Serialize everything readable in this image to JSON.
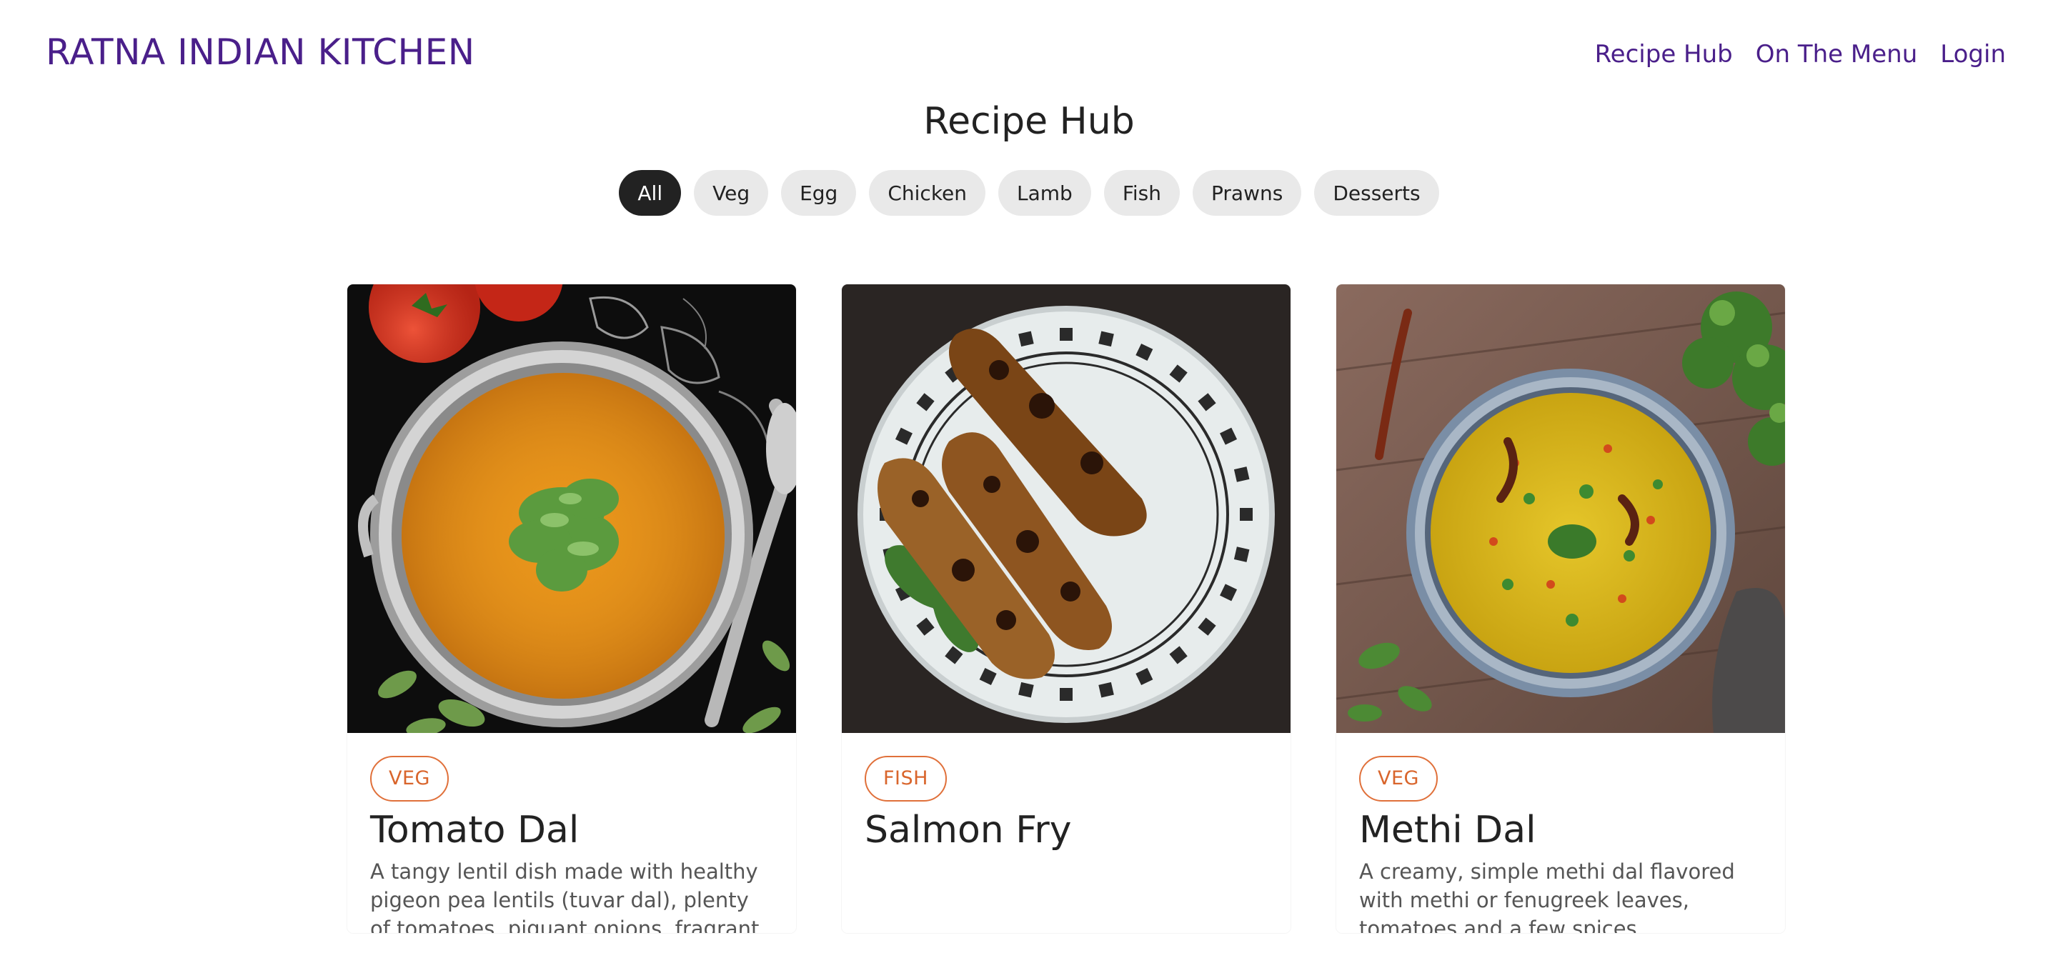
{
  "brand": "RATNA INDIAN KITCHEN",
  "nav": [
    "Recipe Hub",
    "On The Menu",
    "Login"
  ],
  "page_title": "Recipe Hub",
  "filters": {
    "items": [
      "All",
      "Veg",
      "Egg",
      "Chicken",
      "Lamb",
      "Fish",
      "Prawns",
      "Desserts"
    ],
    "active": "All"
  },
  "cards": [
    {
      "tag": "VEG",
      "title": "Tomato Dal",
      "description": "A tangy lentil dish made with healthy pigeon pea lentils (tuvar dal), plenty of tomatoes, piquant onions, fragrant"
    },
    {
      "tag": "FISH",
      "title": "Salmon Fry",
      "description": ""
    },
    {
      "tag": "VEG",
      "title": "Methi Dal",
      "description": "A creamy, simple methi dal flavored with methi or fenugreek leaves, tomatoes and a few spices."
    }
  ],
  "colors": {
    "brand": "#4a1f8a",
    "pill_active": "#222222",
    "pill": "#e9e9e9",
    "tag": "#d9652c"
  }
}
